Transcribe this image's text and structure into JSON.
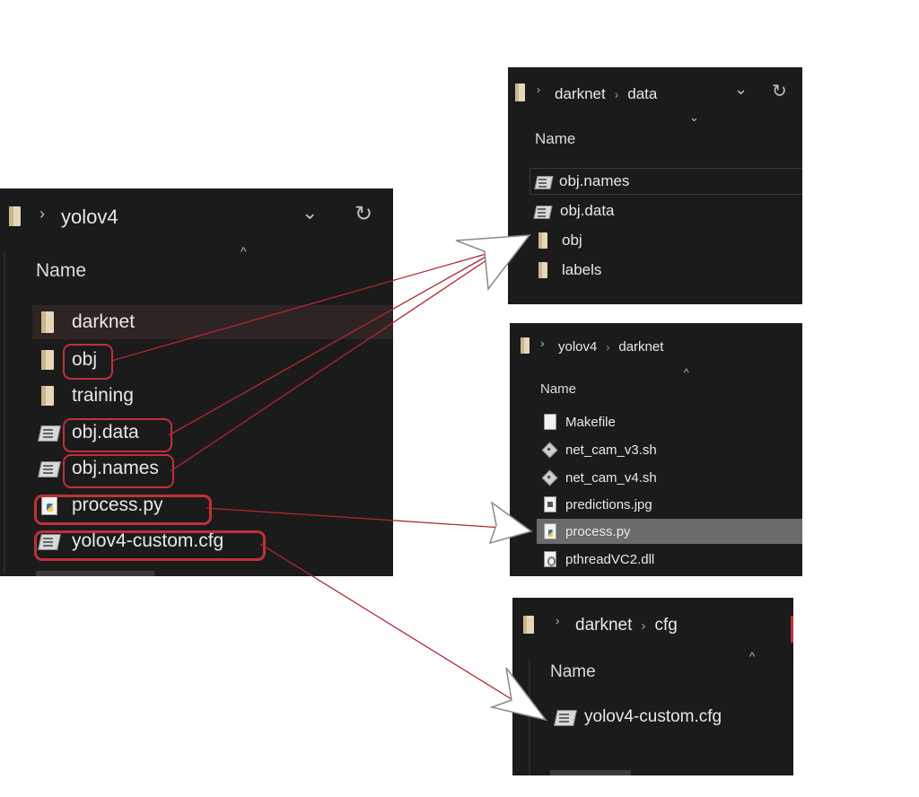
{
  "left_panel": {
    "breadcrumb": [
      "yolov4"
    ],
    "column_header": "Name",
    "items": [
      {
        "name": "darknet",
        "icon": "folder-icon"
      },
      {
        "name": "obj",
        "icon": "folder-icon"
      },
      {
        "name": "training",
        "icon": "folder-icon"
      },
      {
        "name": "obj.data",
        "icon": "config-file-icon"
      },
      {
        "name": "obj.names",
        "icon": "config-file-icon"
      },
      {
        "name": "process.py",
        "icon": "python-file-icon"
      },
      {
        "name": "yolov4-custom.cfg",
        "icon": "config-file-icon"
      }
    ]
  },
  "data_panel": {
    "breadcrumb": [
      "darknet",
      "data"
    ],
    "column_header": "Name",
    "items": [
      {
        "name": "obj.names",
        "icon": "config-file-icon"
      },
      {
        "name": "obj.data",
        "icon": "config-file-icon"
      },
      {
        "name": "obj",
        "icon": "folder-icon"
      },
      {
        "name": "labels",
        "icon": "folder-icon"
      }
    ]
  },
  "darknet_panel": {
    "breadcrumb": [
      "yolov4",
      "darknet"
    ],
    "column_header": "Name",
    "items": [
      {
        "name": "Makefile",
        "icon": "file-icon"
      },
      {
        "name": "net_cam_v3.sh",
        "icon": "shell-script-icon"
      },
      {
        "name": "net_cam_v4.sh",
        "icon": "shell-script-icon"
      },
      {
        "name": "predictions.jpg",
        "icon": "image-file-icon"
      },
      {
        "name": "process.py",
        "icon": "python-file-icon"
      },
      {
        "name": "pthreadVC2.dll",
        "icon": "dll-file-icon"
      }
    ]
  },
  "cfg_panel": {
    "breadcrumb": [
      "darknet",
      "cfg"
    ],
    "column_header": "Name",
    "items": [
      {
        "name": "yolov4-custom.cfg",
        "icon": "config-file-icon"
      }
    ]
  },
  "colors": {
    "panel_bg": "#1b1b1b",
    "highlight_red": "#c0303a",
    "selected_row": "#6b6b6b",
    "hover_row": "#2e2424"
  }
}
